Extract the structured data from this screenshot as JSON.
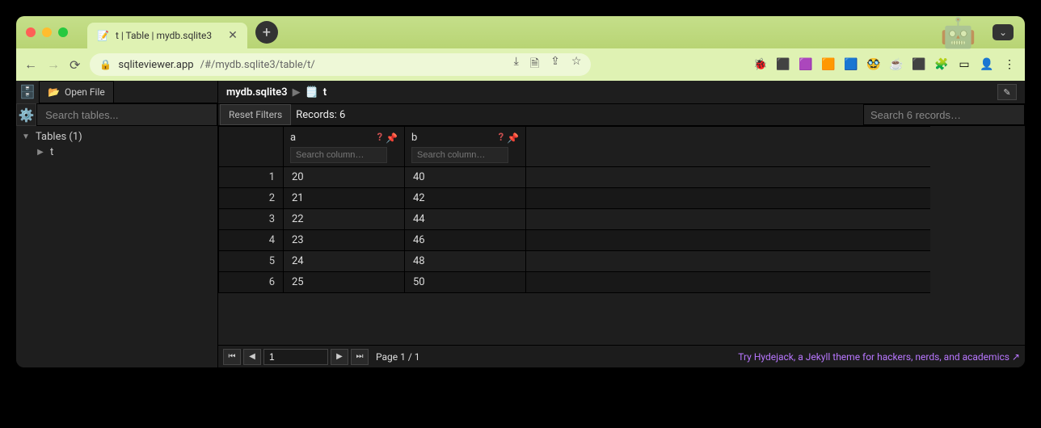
{
  "browser": {
    "tab_title": "t | Table | mydb.sqlite3",
    "url_host": "sqliteviewer.app",
    "url_path": "/#/mydb.sqlite3/table/t/"
  },
  "sidebar": {
    "open_file_label": "Open File",
    "search_placeholder": "Search tables...",
    "tree_header": "Tables (1)",
    "tree_items": [
      {
        "label": "t"
      }
    ]
  },
  "crumb": {
    "db": "mydb.sqlite3",
    "table": "t"
  },
  "toolbar": {
    "reset_label": "Reset Filters",
    "records_label": "Records: 6",
    "search_placeholder": "Search 6 records…"
  },
  "columns": [
    {
      "name": "a",
      "search_placeholder": "Search column…"
    },
    {
      "name": "b",
      "search_placeholder": "Search column…"
    }
  ],
  "rows": [
    {
      "n": "1",
      "a": "20",
      "b": "40"
    },
    {
      "n": "2",
      "a": "21",
      "b": "42"
    },
    {
      "n": "3",
      "a": "22",
      "b": "44"
    },
    {
      "n": "4",
      "a": "23",
      "b": "46"
    },
    {
      "n": "5",
      "a": "24",
      "b": "48"
    },
    {
      "n": "6",
      "a": "25",
      "b": "50"
    }
  ],
  "pager": {
    "current": "1",
    "info": "Page 1 / 1"
  },
  "promo": {
    "text": "Try Hydejack, a Jekyll theme for hackers, nerds, and academics ↗"
  }
}
